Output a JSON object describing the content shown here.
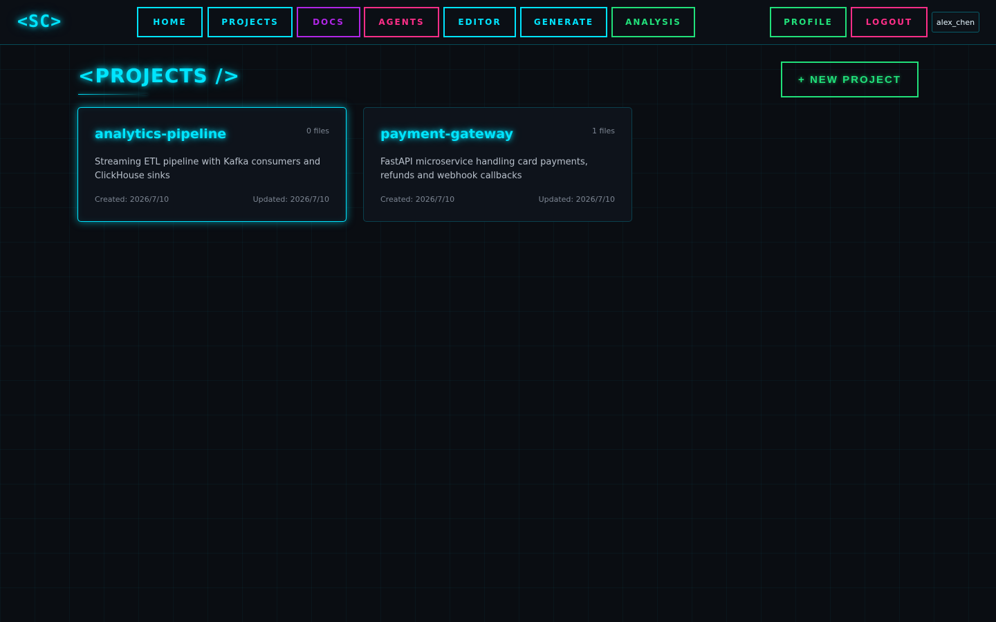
{
  "header": {
    "logo": "<SC>",
    "nav": {
      "home": "HOME",
      "projects": "PROJECTS",
      "docs": "DOCS",
      "agents": "AGENTS",
      "editor": "EDITOR",
      "generate": "GENERATE",
      "analysis": "ANALYSIS"
    },
    "profile": "PROFILE",
    "logout": "LOGOUT",
    "username": "alex_chen"
  },
  "main": {
    "title": "<PROJECTS />",
    "new_project_label": "+ NEW PROJECT",
    "projects": [
      {
        "name": "analytics-pipeline",
        "files": "0 files",
        "description": "Streaming ETL pipeline with Kafka consumers and ClickHouse sinks",
        "created": "Created: 2026/7/10",
        "updated": "Updated: 2026/7/10"
      },
      {
        "name": "payment-gateway",
        "files": "1 files",
        "description": "FastAPI microservice handling card payments, refunds and webhook callbacks",
        "created": "Created: 2026/7/10",
        "updated": "Updated: 2026/7/10"
      }
    ]
  },
  "colors": {
    "background": "#0a0d12",
    "cyan": "#00e5ff",
    "purple": "#b026e6",
    "pink": "#ff2e88",
    "green": "#21e07a"
  }
}
